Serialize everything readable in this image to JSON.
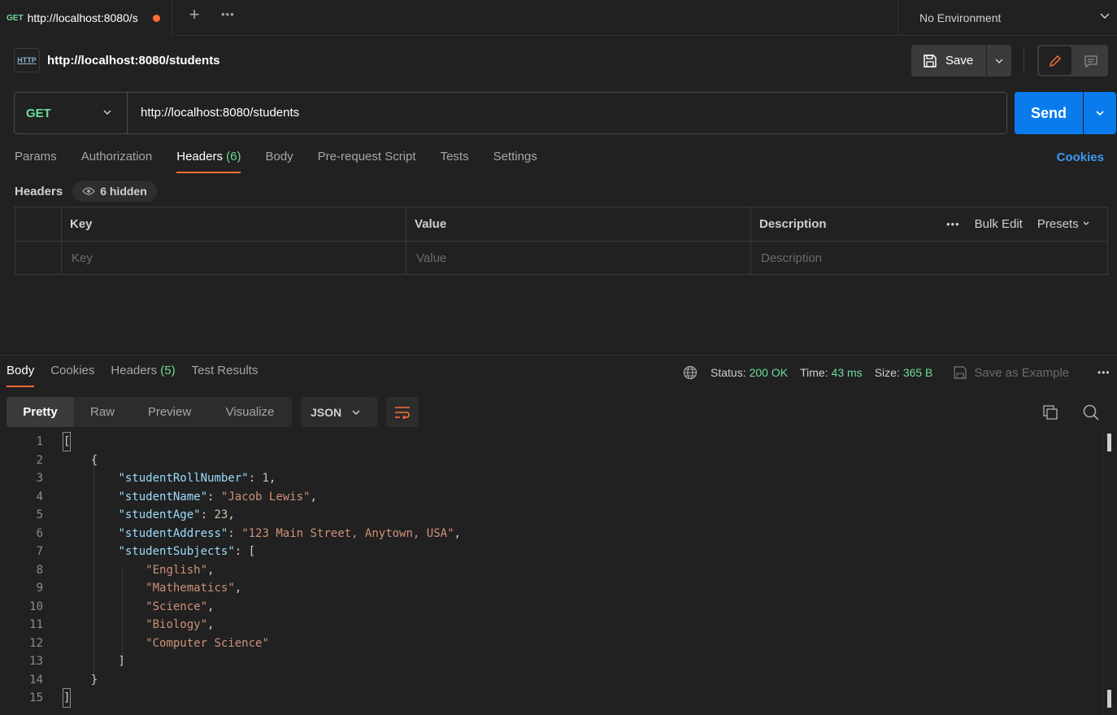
{
  "tab": {
    "method": "GET",
    "url": "http://localhost:8080/s"
  },
  "environment": {
    "label": "No Environment"
  },
  "request": {
    "title": "http://localhost:8080/students",
    "http_icon_label": "HTTP",
    "save_label": "Save",
    "method": "GET",
    "url": "http://localhost:8080/students",
    "send_label": "Send"
  },
  "request_tabs": [
    {
      "label": "Params"
    },
    {
      "label": "Authorization"
    },
    {
      "label": "Headers",
      "count": "(6)"
    },
    {
      "label": "Body"
    },
    {
      "label": "Pre-request Script"
    },
    {
      "label": "Tests"
    },
    {
      "label": "Settings"
    }
  ],
  "cookies_link": "Cookies",
  "headers_section": {
    "label": "Headers",
    "hidden": "6 hidden"
  },
  "headers_table": {
    "columns": [
      "Key",
      "Value",
      "Description"
    ],
    "placeholders": [
      "Key",
      "Value",
      "Description"
    ],
    "bulk_edit": "Bulk Edit",
    "presets": "Presets"
  },
  "response_tabs": [
    {
      "label": "Body"
    },
    {
      "label": "Cookies"
    },
    {
      "label": "Headers",
      "count": "(5)"
    },
    {
      "label": "Test Results"
    }
  ],
  "response_meta": {
    "status_label": "Status:",
    "status": "200 OK",
    "time_label": "Time:",
    "time": "43 ms",
    "size_label": "Size:",
    "size": "365 B",
    "save_example": "Save as Example"
  },
  "view_modes": [
    "Pretty",
    "Raw",
    "Preview",
    "Visualize"
  ],
  "format": "JSON",
  "code_lines": [
    "1",
    "2",
    "3",
    "4",
    "5",
    "6",
    "7",
    "8",
    "9",
    "10",
    "11",
    "12",
    "13",
    "14",
    "15"
  ],
  "body_json": {
    "keys": [
      "studentRollNumber",
      "studentName",
      "studentAge",
      "studentAddress",
      "studentSubjects"
    ],
    "studentRollNumber": "1",
    "studentName": "Jacob Lewis",
    "studentAge": "23",
    "studentAddress": "123 Main Street, Anytown, USA",
    "studentSubjects": [
      "English",
      "Mathematics",
      "Science",
      "Biology",
      "Computer Science"
    ]
  },
  "colors": {
    "accent": "#ff6c37",
    "send": "#097bed",
    "success": "#6bdd9a",
    "link": "#3d99f5"
  }
}
